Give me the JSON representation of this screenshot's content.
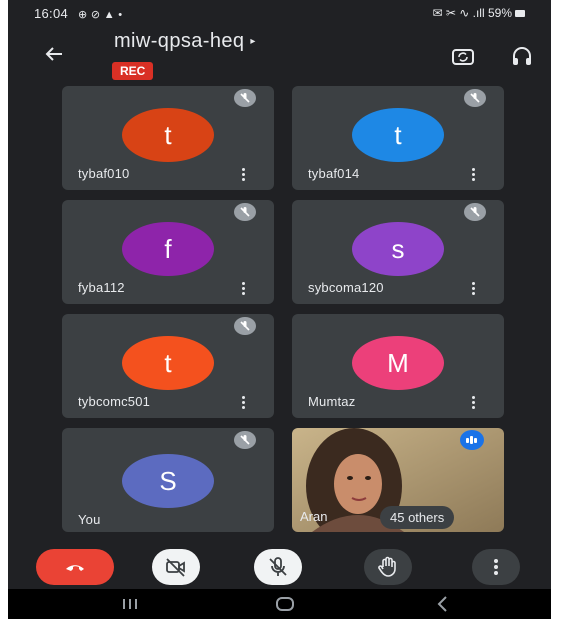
{
  "status_bar": {
    "time": "16:04",
    "left_icons": "⊕ ⊘ ▲ •",
    "right_text": "✉ ✂ ∿ .ıll 59%"
  },
  "header": {
    "meeting_code": "miw-qpsa-heq",
    "rec_label": "REC"
  },
  "tiles": [
    {
      "name": "tybaf010",
      "initial": "t",
      "color": "#d84315"
    },
    {
      "name": "tybaf014",
      "initial": "t",
      "color": "#1e88e5"
    },
    {
      "name": "fyba112",
      "initial": "f",
      "color": "#8e24aa"
    },
    {
      "name": "sybcoma120",
      "initial": "s",
      "color": "#8e44c9"
    },
    {
      "name": "tybcomc501",
      "initial": "t",
      "color": "#f4511e"
    },
    {
      "name": "Mumtaz",
      "initial": "M",
      "color": "#ec407a"
    },
    {
      "name": "You",
      "initial": "S",
      "color": "#5c6bc0"
    }
  ],
  "video_tile": {
    "name": "Aran",
    "others_label": "45 others"
  },
  "colors": {
    "background": "#202124",
    "tile": "#3c4043",
    "end_call": "#ea4335",
    "rec": "#d93025",
    "speaking": "#1a73e8"
  },
  "icons": [
    "back-arrow-icon",
    "switch-camera-icon",
    "headphones-icon",
    "mic-off-icon",
    "more-vert-icon",
    "end-call-icon",
    "camera-off-icon",
    "hand-raise-icon"
  ]
}
